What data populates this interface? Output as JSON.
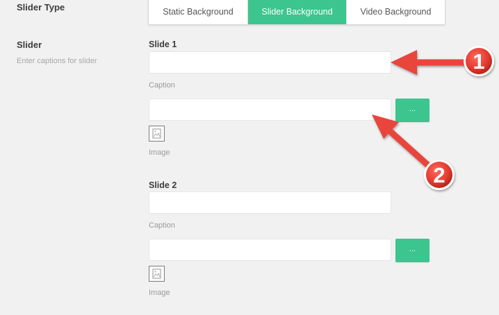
{
  "slider_type": {
    "label": "Slider Type",
    "options": [
      "Static Background",
      "Slider Background",
      "Video Background"
    ],
    "selected": "Slider Background"
  },
  "slider": {
    "label": "Slider",
    "description": "Enter captions for slider",
    "slides": [
      {
        "title": "Slide 1",
        "caption_value": "",
        "caption_label": "Caption",
        "image_value": "",
        "browse_label": "...",
        "image_label": "Image"
      },
      {
        "title": "Slide 2",
        "caption_value": "",
        "caption_label": "Caption",
        "image_value": "",
        "browse_label": "...",
        "image_label": "Image"
      }
    ]
  },
  "annotations": [
    {
      "number": "1",
      "color": "#e8443c"
    },
    {
      "number": "2",
      "color": "#e8443c"
    }
  ],
  "colors": {
    "accent": "#3cc58e",
    "background": "#f1f1f1",
    "annotation_red": "#e8443c"
  }
}
